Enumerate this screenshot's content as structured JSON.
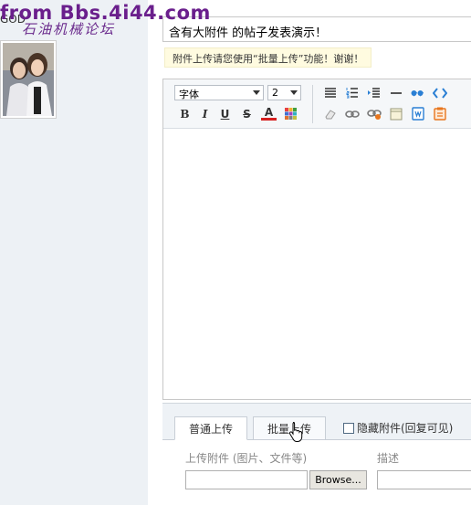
{
  "watermark": {
    "main": "from Bbs.4i44.com",
    "sub": "石油机械论坛"
  },
  "user": {
    "name": "GOD"
  },
  "post": {
    "title": "含有大附件 的帖子发表演示！"
  },
  "notice": {
    "text": "附件上传请您使用“批量上传”功能！谢谢！"
  },
  "editor": {
    "font_select": "字体",
    "size_select": "2",
    "icons": [
      "align-left-icon",
      "ordered-list-icon",
      "indent-icon",
      "horizontal-rule-icon",
      "quote-icon",
      "code-icon",
      "bold-icon",
      "italic-icon",
      "underline-icon",
      "strikethrough-icon",
      "font-color-icon",
      "background-color-icon",
      "remove-format-icon",
      "link-icon",
      "unlink-icon",
      "table-icon",
      "paste-word-icon",
      "paste-text-icon"
    ],
    "buttons": {
      "bold": "B",
      "italic": "I",
      "underline": "U",
      "strike": "S",
      "color": "A"
    },
    "colors": {
      "accent_blue": "#2a7fd4",
      "accent_orange": "#e8761e",
      "font_color_red": "#d62020"
    }
  },
  "upload": {
    "tab_normal": "普通上传",
    "tab_batch": "批量上传",
    "hide_attachment": "隐藏附件(回复可见)",
    "file_label": "上传附件 (图片、文件等)",
    "desc_label": "描述",
    "browse": "Browse..."
  }
}
